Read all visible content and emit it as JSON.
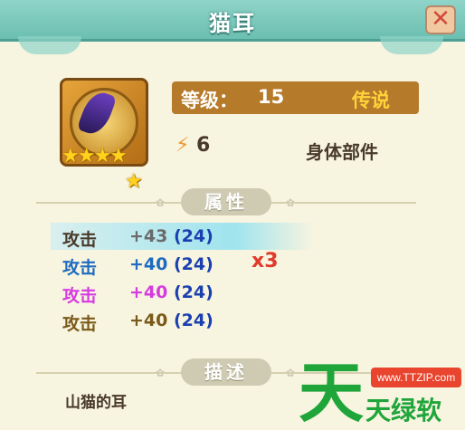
{
  "title": "猫耳",
  "close_icon": "close-x-icon",
  "item": {
    "icon": "purple-cat-ear-icon",
    "stars": "★★★★",
    "extra_star": "★"
  },
  "level": {
    "label": "等级：",
    "value": "15",
    "rarity": "传说"
  },
  "power": {
    "icon": "lightning-icon",
    "glyph": "⚡",
    "value": "6"
  },
  "part_type": "身体部件",
  "attributes": {
    "header": "属性",
    "rows": [
      {
        "name": "攻击",
        "value": "+43",
        "base": "(24)",
        "color": "#4a3a2a",
        "value_color": "#6a6a6a"
      },
      {
        "name": "攻击",
        "value": "+40",
        "base": "(24)",
        "color": "#1f6bbf",
        "value_color": "#1f6bbf"
      },
      {
        "name": "攻击",
        "value": "+40",
        "base": "(24)",
        "color": "#d63be0",
        "value_color": "#d63be0"
      },
      {
        "name": "攻击",
        "value": "+40",
        "base": "(24)",
        "color": "#7a5a1a",
        "value_color": "#7a5a1a"
      }
    ],
    "multiplier": "x3"
  },
  "description": {
    "header": "描述",
    "text": "山猫的耳"
  },
  "watermark": {
    "big": "天",
    "url": "www.TTZIP.com",
    "name": "天绿软"
  },
  "colors": {
    "title_bar": "#6bbfb1",
    "level_bar": "#b57a2a",
    "rarity": "#ffd33a",
    "background": "#f7f4e0"
  }
}
